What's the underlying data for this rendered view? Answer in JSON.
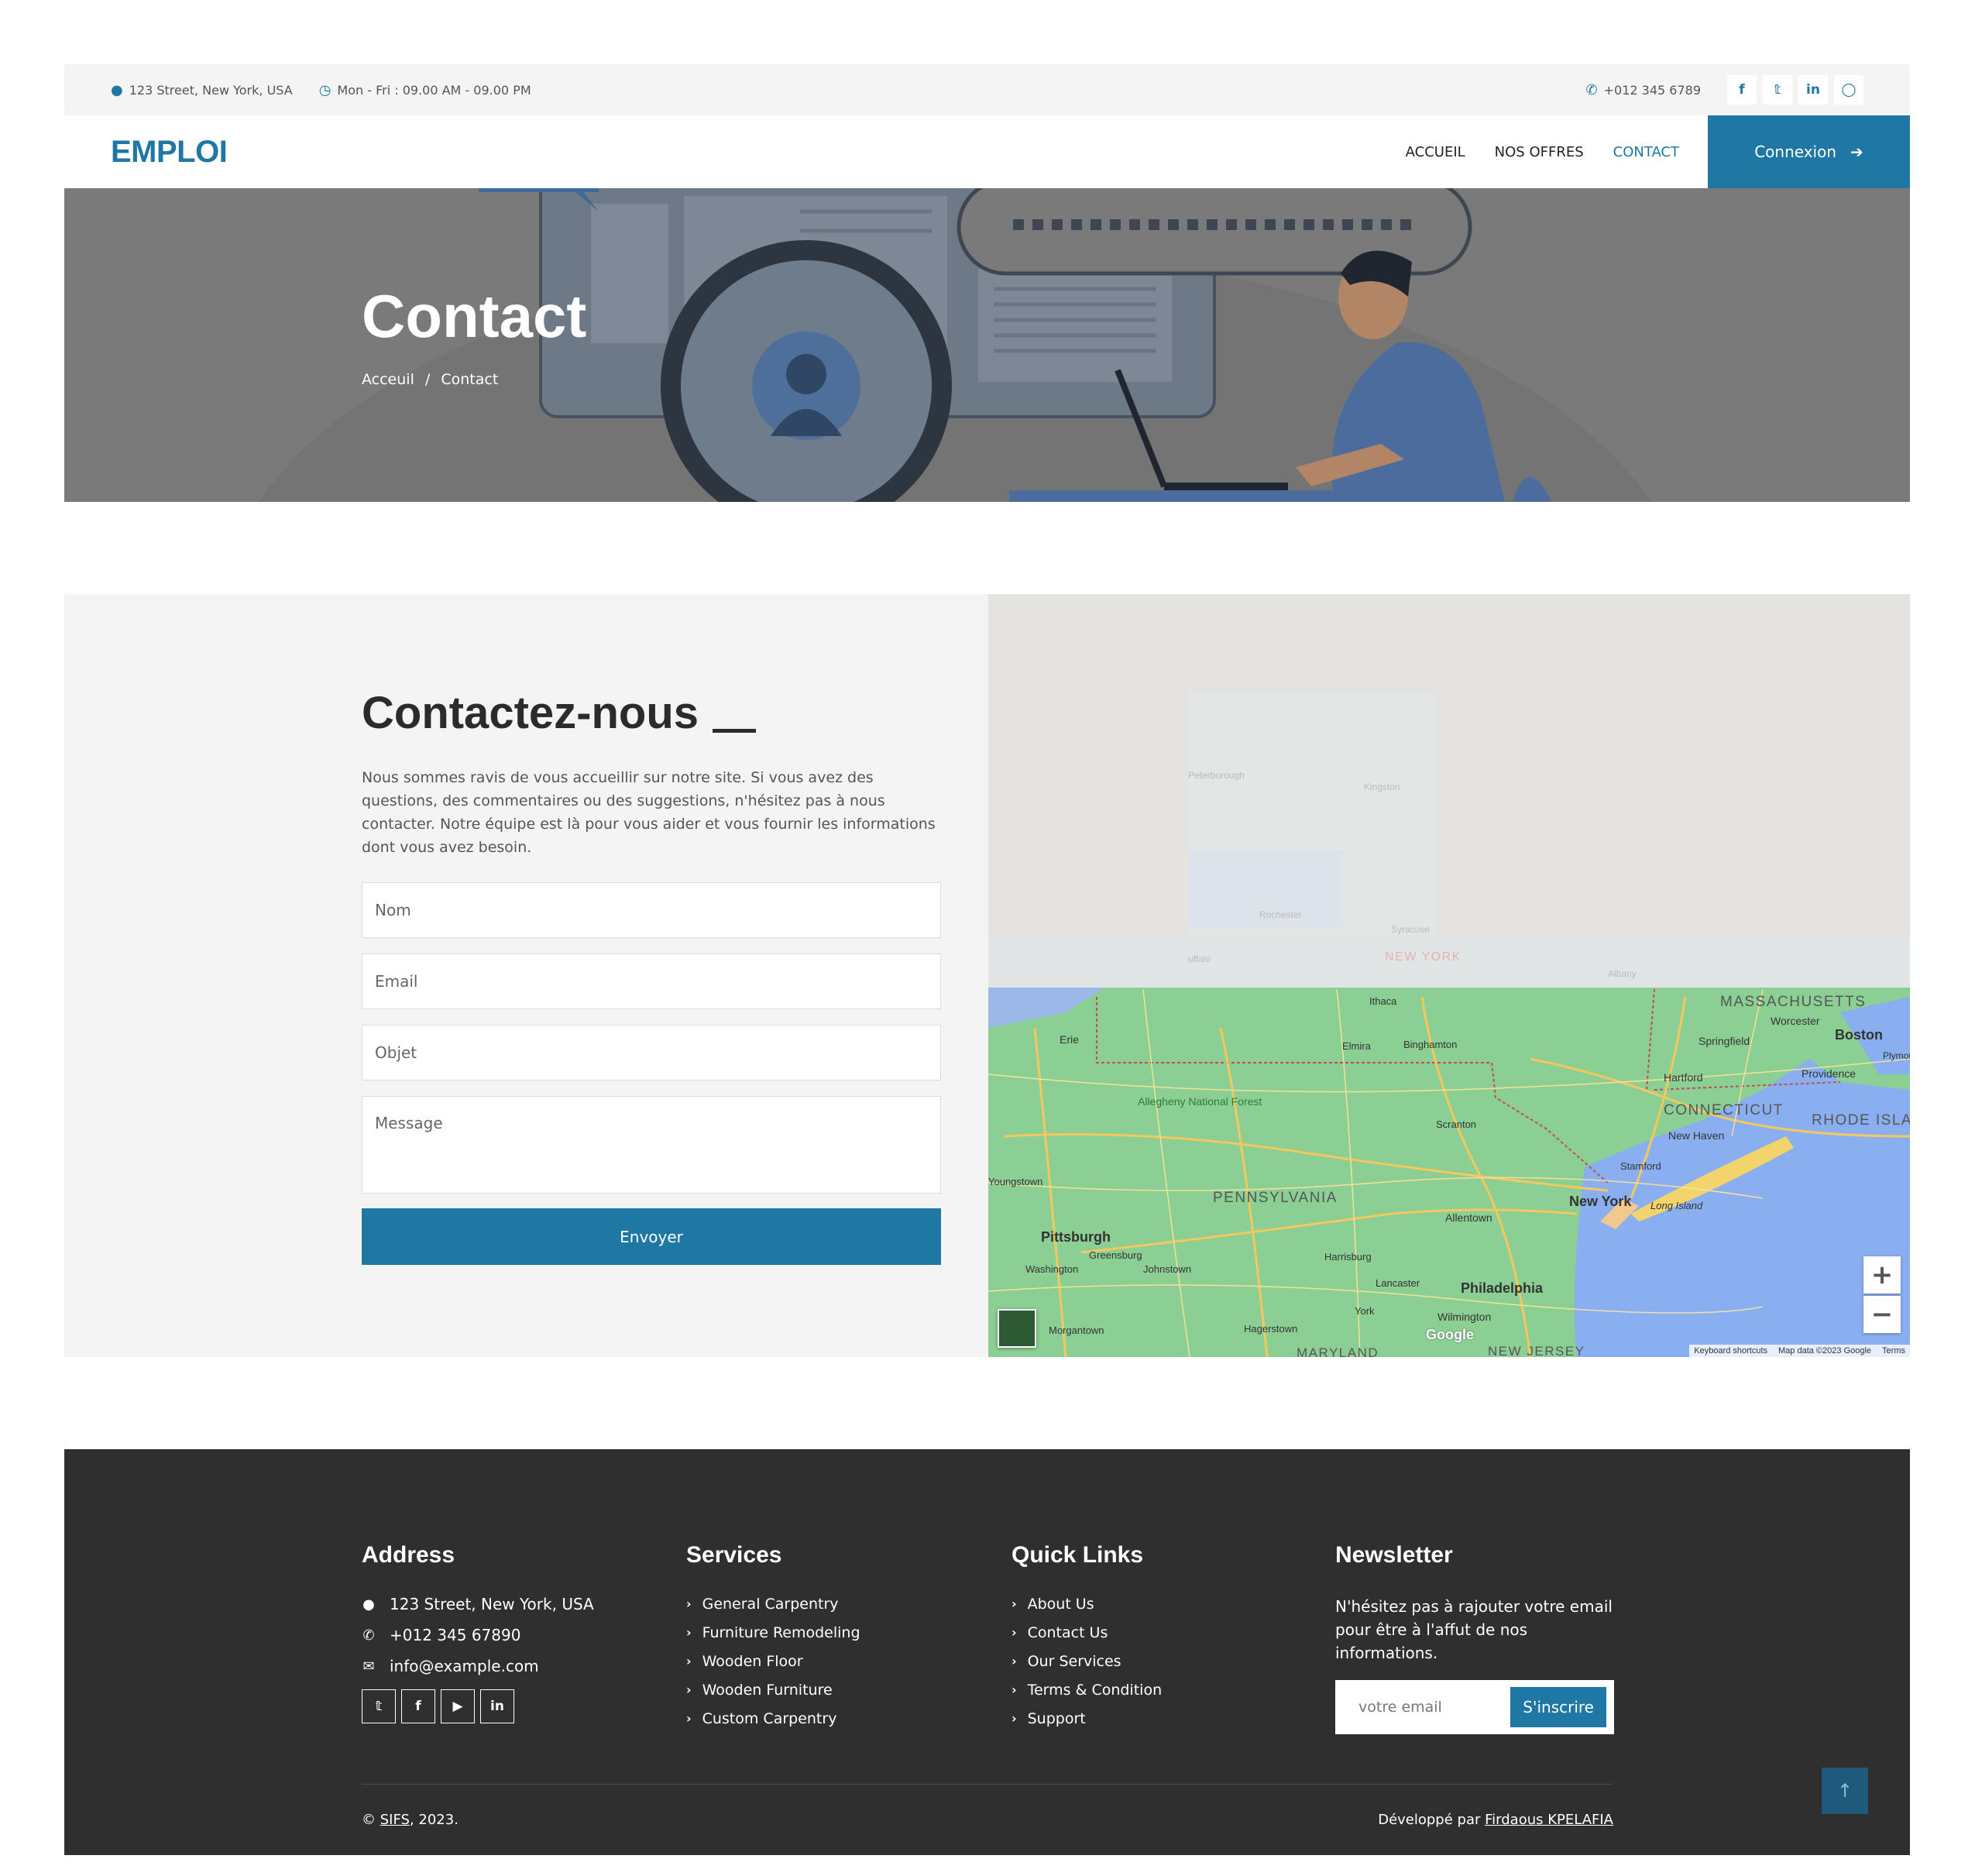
{
  "topbar": {
    "address": "123 Street, New York, USA",
    "hours": "Mon - Fri : 09.00 AM - 09.00 PM",
    "phone": "+012 345 6789",
    "socials": [
      "f",
      "t",
      "in",
      "ig"
    ]
  },
  "navbar": {
    "logo": "EMPLOI",
    "links": [
      {
        "label": "ACCUEIL"
      },
      {
        "label": "NOS OFFRES"
      },
      {
        "label": "CONTACT"
      }
    ],
    "connexion": "Connexion",
    "active_color": "#1f77a4"
  },
  "hero": {
    "title": "Contact",
    "breadcrumb": [
      "Acceuil",
      "/",
      "Contact"
    ]
  },
  "contact": {
    "title": "Contactez-nous",
    "text": "Nous sommes ravis de vous accueillir sur notre site. Si vous avez des questions, des commentaires ou des suggestions, n'hésitez pas à nous contacter. Notre équipe est là pour vous aider et vous fournir les informations dont vous avez besoin.",
    "placeholders": {
      "name": "Nom",
      "email": "Email",
      "subject": "Objet",
      "message": "Message"
    },
    "submit": "Envoyer"
  },
  "map": {
    "labels": {
      "massachusetts": "MASSACHUSETTS",
      "boston": "Boston",
      "worcester": "Worcester",
      "springfield": "Springfield",
      "hartford": "Hartford",
      "providence": "Providence",
      "connecticut": "CONNECTICUT",
      "rhode_island": "RHODE ISLAND",
      "new_haven": "New Haven",
      "stamford": "Stamford",
      "new_york": "New York",
      "long_island": "Long Island",
      "pennsylvania": "PENNSYLVANIA",
      "pittsburgh": "Pittsburgh",
      "philadelphia": "Philadelphia",
      "allentown": "Allentown",
      "harrisburg": "Harrisburg",
      "scranton": "Scranton",
      "erie": "Erie",
      "elmira": "Elmira",
      "binghamton": "Binghamton",
      "ithaca": "Ithaca",
      "allegheny": "Allegheny National Forest",
      "youngstown": "Youngstown",
      "greensburg": "Greensburg",
      "washington": "Washington",
      "johnstown": "Johnstown",
      "lancaster": "Lancaster",
      "york": "York",
      "wilmington": "Wilmington",
      "morgantown": "Morgantown",
      "hagerstown": "Hagerstown",
      "maryland": "MARYLAND",
      "new_jersey": "NEW JERSEY",
      "new_york_state": "NEW YORK",
      "rochester": "Rochester",
      "syracuse": "Syracuse",
      "kingston": "Kingston",
      "peterborough": "Peterborough",
      "buffalo": "uffalo",
      "albany": "Albany",
      "plymouth": "Plymou"
    },
    "zoom_in": "+",
    "zoom_out": "−",
    "google": "Google",
    "attribution": [
      "Keyboard shortcuts",
      "Map data ©2023 Google",
      "Terms"
    ]
  },
  "footer": {
    "address": {
      "title": "Address",
      "street": "123 Street, New York, USA",
      "phone": "+012 345 67890",
      "email": "info@example.com",
      "socials": [
        "t",
        "f",
        "yt",
        "in"
      ]
    },
    "services": {
      "title": "Services",
      "items": [
        "General Carpentry",
        "Furniture Remodeling",
        "Wooden Floor",
        "Wooden Furniture",
        "Custom Carpentry"
      ]
    },
    "quick_links": {
      "title": "Quick Links",
      "items": [
        "About Us",
        "Contact Us",
        "Our Services",
        "Terms & Condition",
        "Support"
      ]
    },
    "newsletter": {
      "title": "Newsletter",
      "text": "N'hésitez pas à rajouter votre email pour être à l'affut de nos informations.",
      "placeholder": "votre email",
      "button": "S'inscrire"
    },
    "copyright_prefix": "©",
    "copyright_brand": "SIFS",
    "copyright_suffix": ", 2023.",
    "dev_prefix": "Développé par",
    "dev_name": "Firdaous KPELAFIA",
    "totop": "↑"
  }
}
